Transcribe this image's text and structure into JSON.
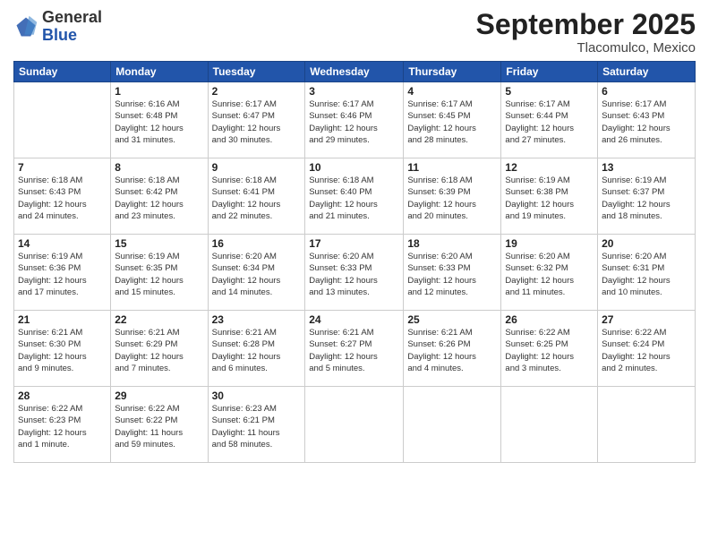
{
  "header": {
    "logo_general": "General",
    "logo_blue": "Blue",
    "month": "September 2025",
    "location": "Tlacomulco, Mexico"
  },
  "days_of_week": [
    "Sunday",
    "Monday",
    "Tuesday",
    "Wednesday",
    "Thursday",
    "Friday",
    "Saturday"
  ],
  "weeks": [
    [
      {
        "day": "",
        "info": ""
      },
      {
        "day": "1",
        "info": "Sunrise: 6:16 AM\nSunset: 6:48 PM\nDaylight: 12 hours\nand 31 minutes."
      },
      {
        "day": "2",
        "info": "Sunrise: 6:17 AM\nSunset: 6:47 PM\nDaylight: 12 hours\nand 30 minutes."
      },
      {
        "day": "3",
        "info": "Sunrise: 6:17 AM\nSunset: 6:46 PM\nDaylight: 12 hours\nand 29 minutes."
      },
      {
        "day": "4",
        "info": "Sunrise: 6:17 AM\nSunset: 6:45 PM\nDaylight: 12 hours\nand 28 minutes."
      },
      {
        "day": "5",
        "info": "Sunrise: 6:17 AM\nSunset: 6:44 PM\nDaylight: 12 hours\nand 27 minutes."
      },
      {
        "day": "6",
        "info": "Sunrise: 6:17 AM\nSunset: 6:43 PM\nDaylight: 12 hours\nand 26 minutes."
      }
    ],
    [
      {
        "day": "7",
        "info": "Sunrise: 6:18 AM\nSunset: 6:43 PM\nDaylight: 12 hours\nand 24 minutes."
      },
      {
        "day": "8",
        "info": "Sunrise: 6:18 AM\nSunset: 6:42 PM\nDaylight: 12 hours\nand 23 minutes."
      },
      {
        "day": "9",
        "info": "Sunrise: 6:18 AM\nSunset: 6:41 PM\nDaylight: 12 hours\nand 22 minutes."
      },
      {
        "day": "10",
        "info": "Sunrise: 6:18 AM\nSunset: 6:40 PM\nDaylight: 12 hours\nand 21 minutes."
      },
      {
        "day": "11",
        "info": "Sunrise: 6:18 AM\nSunset: 6:39 PM\nDaylight: 12 hours\nand 20 minutes."
      },
      {
        "day": "12",
        "info": "Sunrise: 6:19 AM\nSunset: 6:38 PM\nDaylight: 12 hours\nand 19 minutes."
      },
      {
        "day": "13",
        "info": "Sunrise: 6:19 AM\nSunset: 6:37 PM\nDaylight: 12 hours\nand 18 minutes."
      }
    ],
    [
      {
        "day": "14",
        "info": "Sunrise: 6:19 AM\nSunset: 6:36 PM\nDaylight: 12 hours\nand 17 minutes."
      },
      {
        "day": "15",
        "info": "Sunrise: 6:19 AM\nSunset: 6:35 PM\nDaylight: 12 hours\nand 15 minutes."
      },
      {
        "day": "16",
        "info": "Sunrise: 6:20 AM\nSunset: 6:34 PM\nDaylight: 12 hours\nand 14 minutes."
      },
      {
        "day": "17",
        "info": "Sunrise: 6:20 AM\nSunset: 6:33 PM\nDaylight: 12 hours\nand 13 minutes."
      },
      {
        "day": "18",
        "info": "Sunrise: 6:20 AM\nSunset: 6:33 PM\nDaylight: 12 hours\nand 12 minutes."
      },
      {
        "day": "19",
        "info": "Sunrise: 6:20 AM\nSunset: 6:32 PM\nDaylight: 12 hours\nand 11 minutes."
      },
      {
        "day": "20",
        "info": "Sunrise: 6:20 AM\nSunset: 6:31 PM\nDaylight: 12 hours\nand 10 minutes."
      }
    ],
    [
      {
        "day": "21",
        "info": "Sunrise: 6:21 AM\nSunset: 6:30 PM\nDaylight: 12 hours\nand 9 minutes."
      },
      {
        "day": "22",
        "info": "Sunrise: 6:21 AM\nSunset: 6:29 PM\nDaylight: 12 hours\nand 7 minutes."
      },
      {
        "day": "23",
        "info": "Sunrise: 6:21 AM\nSunset: 6:28 PM\nDaylight: 12 hours\nand 6 minutes."
      },
      {
        "day": "24",
        "info": "Sunrise: 6:21 AM\nSunset: 6:27 PM\nDaylight: 12 hours\nand 5 minutes."
      },
      {
        "day": "25",
        "info": "Sunrise: 6:21 AM\nSunset: 6:26 PM\nDaylight: 12 hours\nand 4 minutes."
      },
      {
        "day": "26",
        "info": "Sunrise: 6:22 AM\nSunset: 6:25 PM\nDaylight: 12 hours\nand 3 minutes."
      },
      {
        "day": "27",
        "info": "Sunrise: 6:22 AM\nSunset: 6:24 PM\nDaylight: 12 hours\nand 2 minutes."
      }
    ],
    [
      {
        "day": "28",
        "info": "Sunrise: 6:22 AM\nSunset: 6:23 PM\nDaylight: 12 hours\nand 1 minute."
      },
      {
        "day": "29",
        "info": "Sunrise: 6:22 AM\nSunset: 6:22 PM\nDaylight: 11 hours\nand 59 minutes."
      },
      {
        "day": "30",
        "info": "Sunrise: 6:23 AM\nSunset: 6:21 PM\nDaylight: 11 hours\nand 58 minutes."
      },
      {
        "day": "",
        "info": ""
      },
      {
        "day": "",
        "info": ""
      },
      {
        "day": "",
        "info": ""
      },
      {
        "day": "",
        "info": ""
      }
    ]
  ]
}
